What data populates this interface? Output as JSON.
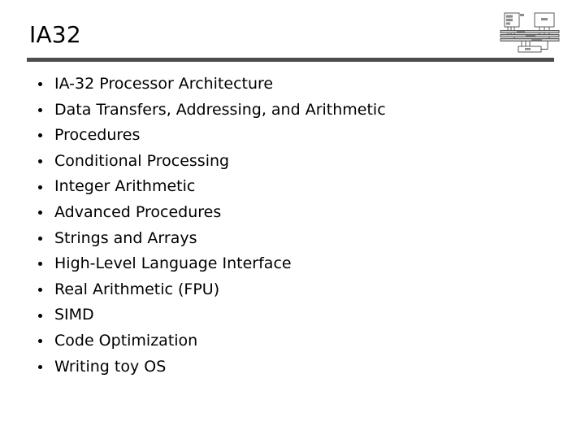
{
  "slide": {
    "title": "IA32",
    "accent_color": "#4d4d4d",
    "text_color": "#000000",
    "background_color": "#ffffff"
  },
  "corner_diagram": {
    "name": "computer-architecture-diagram",
    "description": "Block diagram with CPU, Memory, system buses and an I/O device",
    "blocks": [
      {
        "label": "CPU"
      },
      {
        "label": "Memory"
      },
      {
        "label": "I/O"
      }
    ],
    "buses": [
      {
        "label": "Data"
      },
      {
        "label": "Address"
      },
      {
        "label": "Control"
      }
    ],
    "line_color": "#4a4a4a"
  },
  "bullets": [
    {
      "label": "IA-32 Processor Architecture"
    },
    {
      "label": "Data Transfers, Addressing, and Arithmetic"
    },
    {
      "label": "Procedures"
    },
    {
      "label": "Conditional Processing"
    },
    {
      "label": "Integer Arithmetic"
    },
    {
      "label": "Advanced Procedures"
    },
    {
      "label": "Strings and Arrays"
    },
    {
      "label": "High-Level Language Interface"
    },
    {
      "label": "Real Arithmetic (FPU)"
    },
    {
      "label": "SIMD"
    },
    {
      "label": "Code Optimization"
    },
    {
      "label": "Writing toy OS"
    }
  ]
}
